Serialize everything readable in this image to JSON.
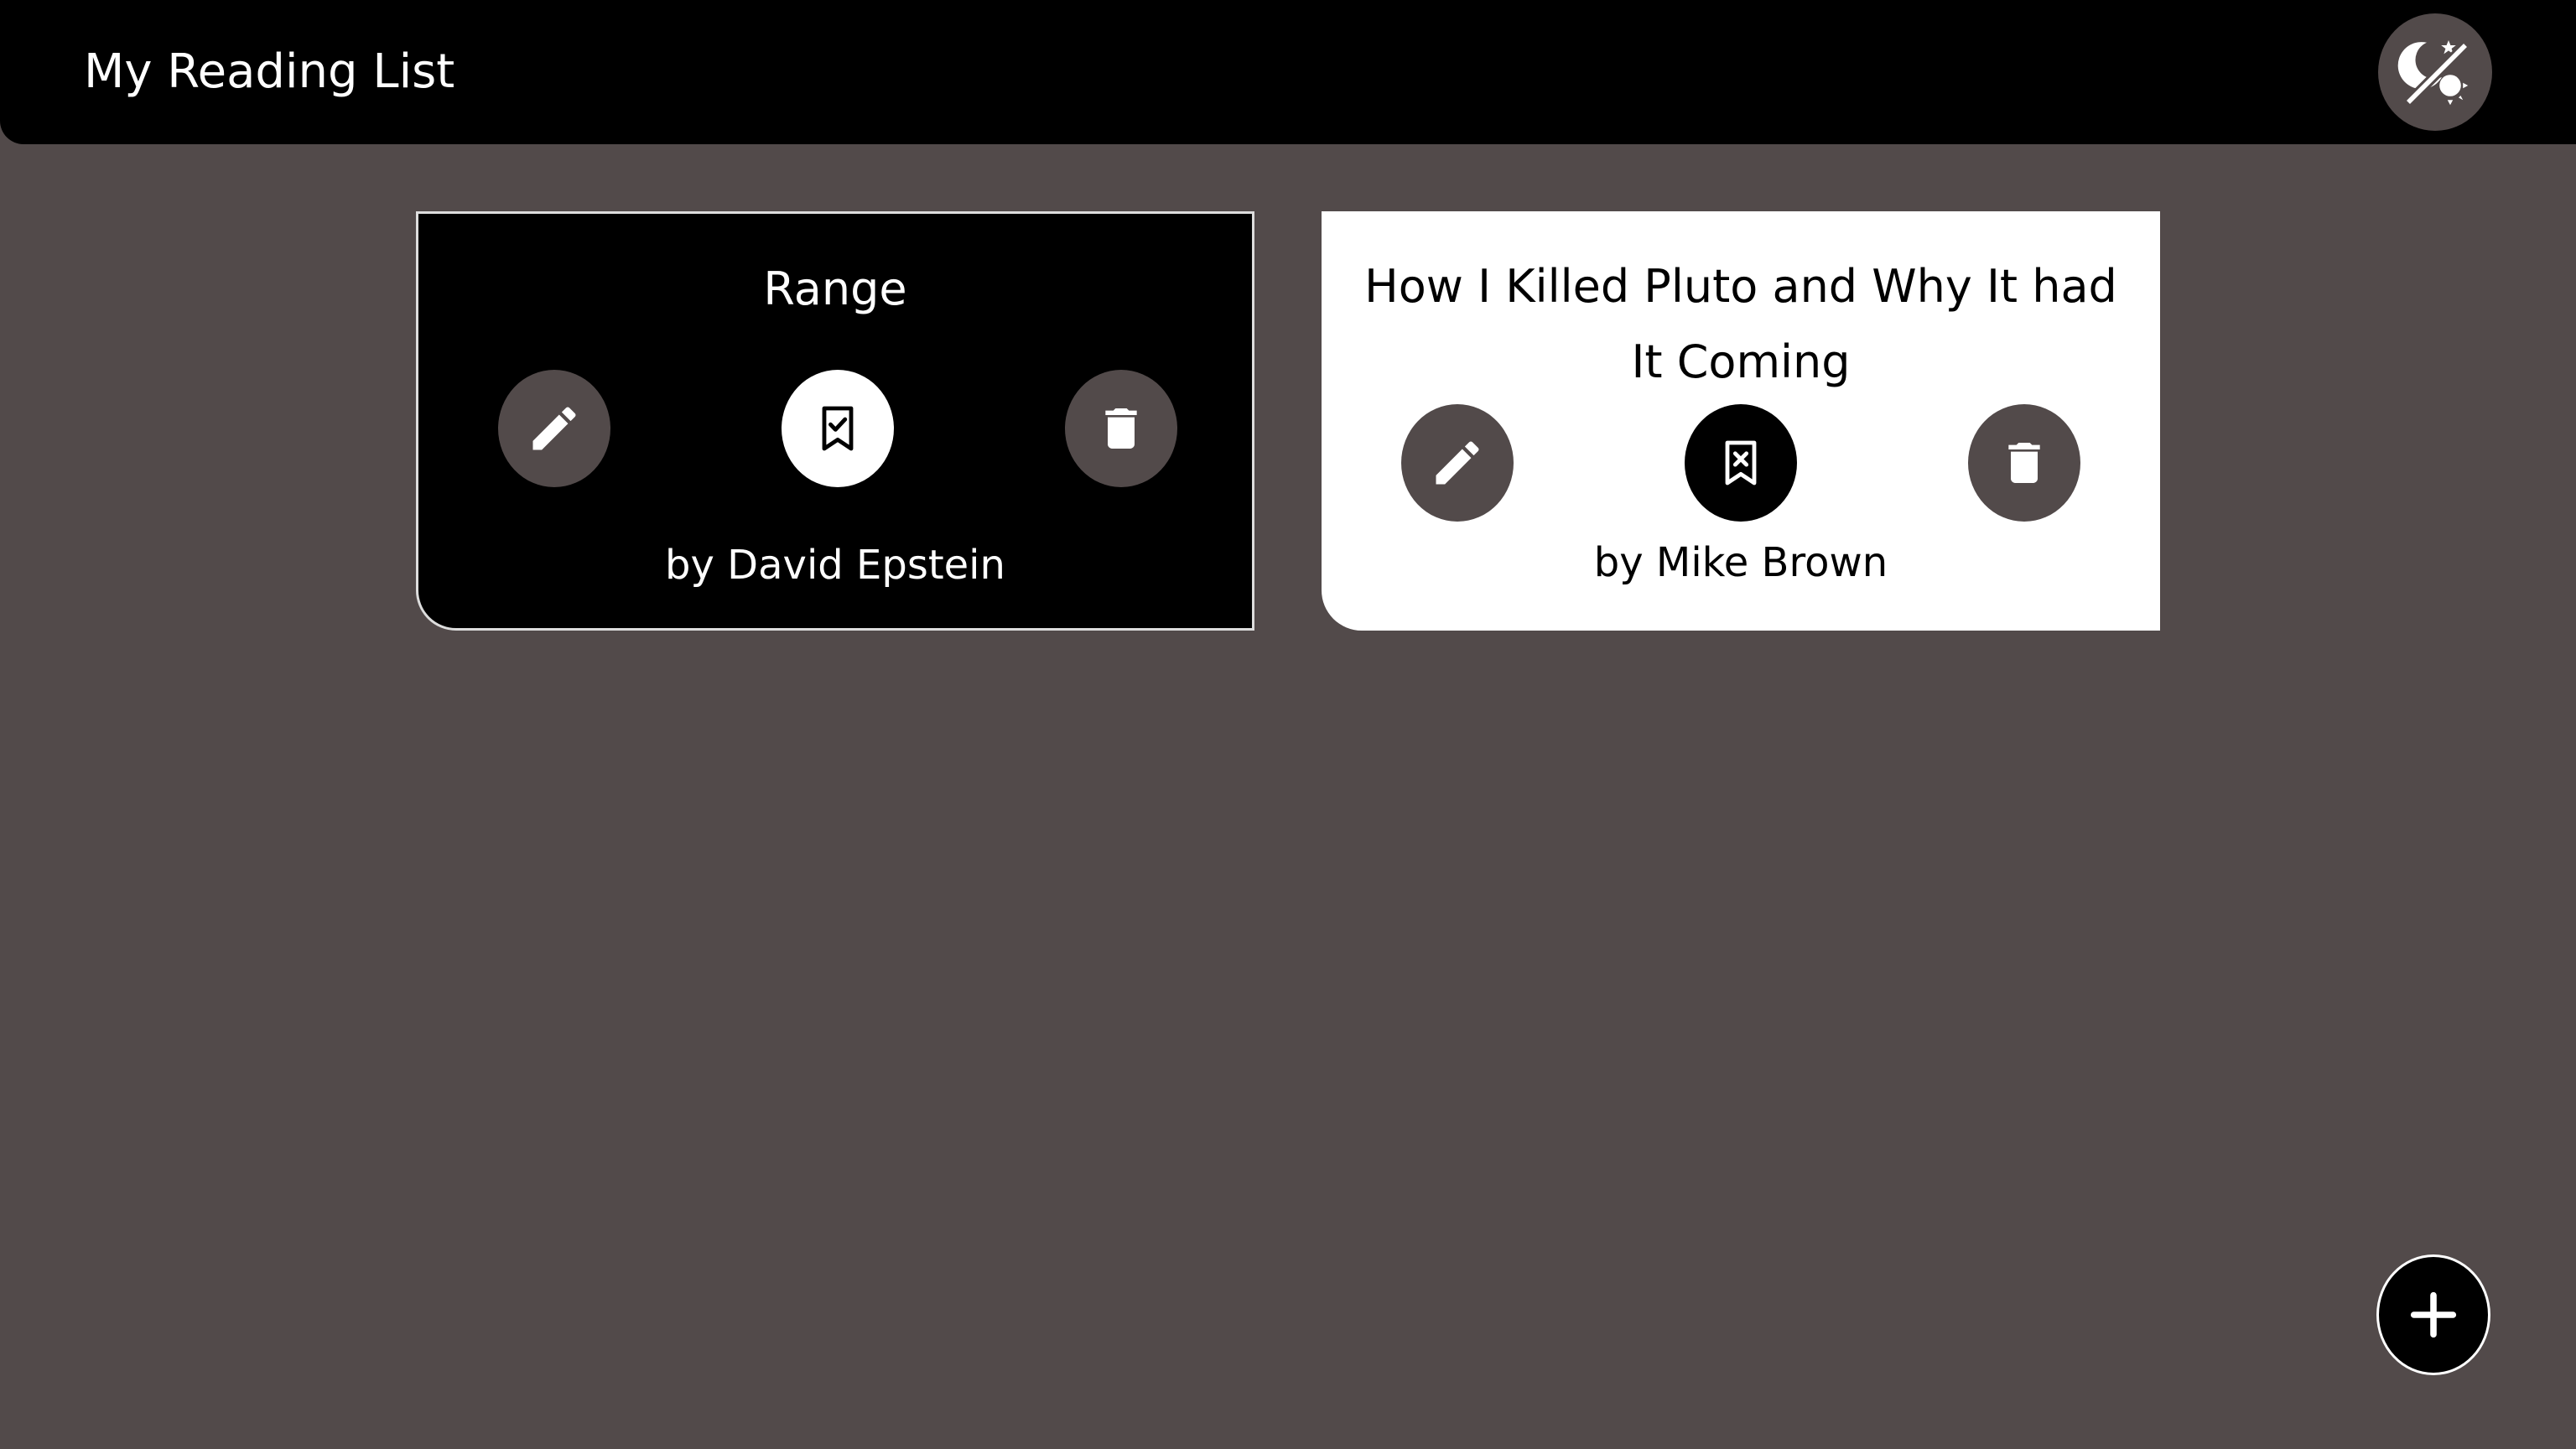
{
  "app_bar": {
    "title": "My Reading List",
    "theme_toggle_icon": "theme-toggle-icon"
  },
  "books": [
    {
      "title": "Range",
      "author": "by David Epstein",
      "card_style": "dark",
      "status_icon": "bookmark-check-icon"
    },
    {
      "title": "How I Killed Pluto and Why It had It Coming",
      "author": "by Mike Brown",
      "card_style": "light",
      "status_icon": "bookmark-remove-icon"
    }
  ],
  "fab": {
    "icon": "plus-icon"
  },
  "colors": {
    "background": "#524a4a",
    "app_bar": "#000000",
    "text_light": "#ffffff",
    "text_dark": "#000000"
  }
}
